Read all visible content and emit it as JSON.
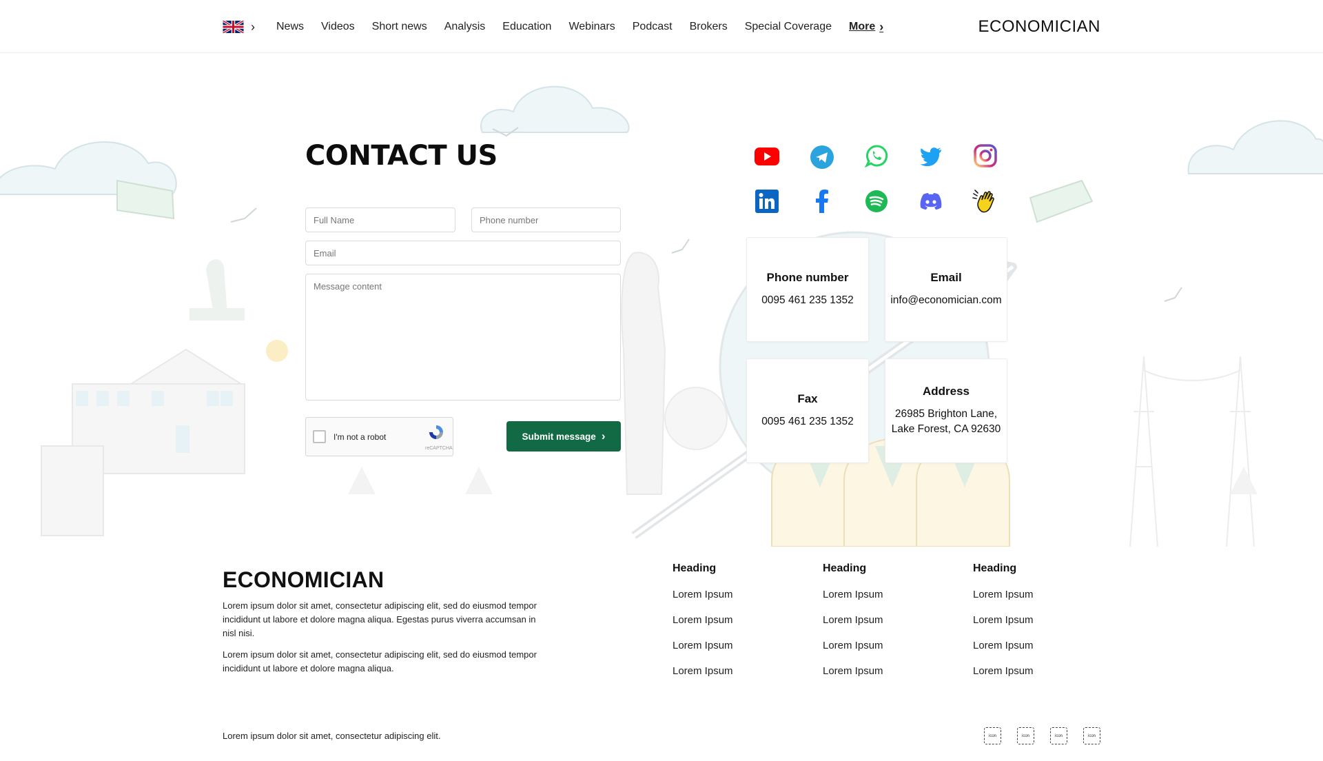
{
  "header": {
    "language_icon": "uk-flag-icon",
    "nav": [
      "News",
      "Videos",
      "Short news",
      "Analysis",
      "Education",
      "Webinars",
      "Podcast",
      "Brokers",
      "Special Coverage"
    ],
    "more_label": "More",
    "brand": "ECONOMICIAN"
  },
  "contact": {
    "title": "CONTACT US",
    "form": {
      "full_name_placeholder": "Full Name",
      "phone_placeholder": "Phone number",
      "email_placeholder": "Email",
      "message_placeholder": "Message content",
      "captcha_label": "I'm not a robot",
      "captcha_brand": "reCAPTCHA",
      "submit_label": "Submit message"
    },
    "social": [
      "youtube",
      "telegram",
      "whatsapp",
      "twitter",
      "instagram",
      "linkedin",
      "facebook",
      "spotify",
      "discord",
      "clubhouse"
    ],
    "cards": {
      "phone": {
        "title": "Phone number",
        "value": "0095 461 235 1352"
      },
      "email": {
        "title": "Email",
        "value": "info@economician.com"
      },
      "fax": {
        "title": "Fax",
        "value": "0095 461 235 1352"
      },
      "address": {
        "title": "Address",
        "line1": "26985 Brighton Lane,",
        "line2": "Lake Forest, CA 92630"
      }
    }
  },
  "footer": {
    "brand": "ECONOMICIAN",
    "para1": "Lorem ipsum dolor sit amet, consectetur adipiscing elit, sed do eiusmod tempor incididunt ut labore et dolore magna aliqua. Egestas purus viverra accumsan in nisl nisi.",
    "para2": "Lorem ipsum dolor sit amet, consectetur adipiscing elit, sed do eiusmod tempor incididunt ut labore et dolore magna aliqua.",
    "columns": [
      {
        "heading": "Heading",
        "links": [
          "Lorem Ipsum",
          "Lorem Ipsum",
          "Lorem Ipsum",
          "Lorem Ipsum"
        ]
      },
      {
        "heading": "Heading",
        "links": [
          "Lorem Ipsum",
          "Lorem Ipsum",
          "Lorem Ipsum",
          "Lorem Ipsum"
        ]
      },
      {
        "heading": "Heading",
        "links": [
          "Lorem Ipsum",
          "Lorem Ipsum",
          "Lorem Ipsum",
          "Lorem Ipsum"
        ]
      }
    ],
    "copyright": "Lorem ipsum dolor sit amet, consectetur adipiscing elit.",
    "icon_label": "icon",
    "icon_count": 4
  },
  "colors": {
    "accent_green": "#116a43",
    "youtube": "#ff0000",
    "telegram": "#2aa3de",
    "whatsapp": "#25d366",
    "twitter": "#1da1f2",
    "linkedin": "#0a66c2",
    "facebook": "#1877f2",
    "spotify": "#1db954",
    "discord": "#5865f2"
  }
}
